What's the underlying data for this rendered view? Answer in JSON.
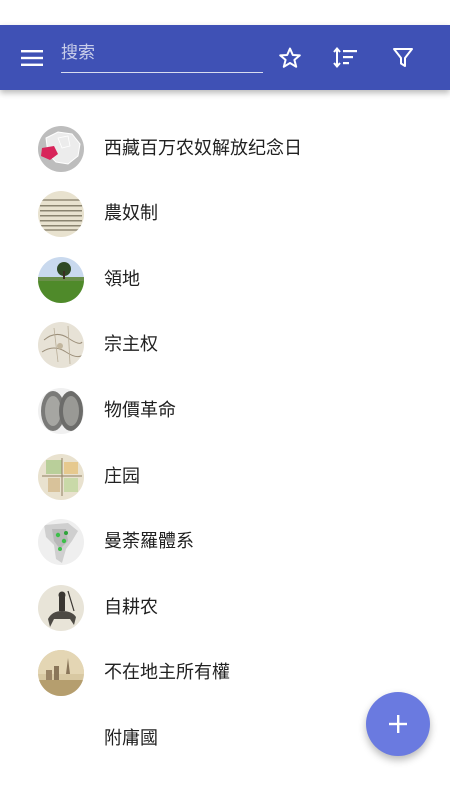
{
  "search": {
    "placeholder": "搜索",
    "value": ""
  },
  "toolbar": {
    "menu_icon": "menu-icon",
    "favorite_icon": "star-outline-icon",
    "sort_icon": "sort-icon",
    "filter_icon": "filter-icon"
  },
  "list": {
    "items": [
      {
        "label": "西藏百万农奴解放纪念日",
        "thumb": "map-china-tibet"
      },
      {
        "label": "農奴制",
        "thumb": "old-document"
      },
      {
        "label": "領地",
        "thumb": "green-field-tree"
      },
      {
        "label": "宗主权",
        "thumb": "old-map"
      },
      {
        "label": "物價革命",
        "thumb": "silver-coins"
      },
      {
        "label": "庄园",
        "thumb": "manor-map"
      },
      {
        "label": "曼荼羅體系",
        "thumb": "southeast-asia-map"
      },
      {
        "label": "自耕农",
        "thumb": "horse-rider-engraving"
      },
      {
        "label": "不在地主所有權",
        "thumb": "painting-town"
      },
      {
        "label": "附庸國",
        "thumb": "none"
      }
    ]
  },
  "fab": {
    "icon": "plus-icon"
  },
  "colors": {
    "app_bar": "#3f51b5",
    "fab": "#6a7ae0",
    "text": "#212121"
  }
}
